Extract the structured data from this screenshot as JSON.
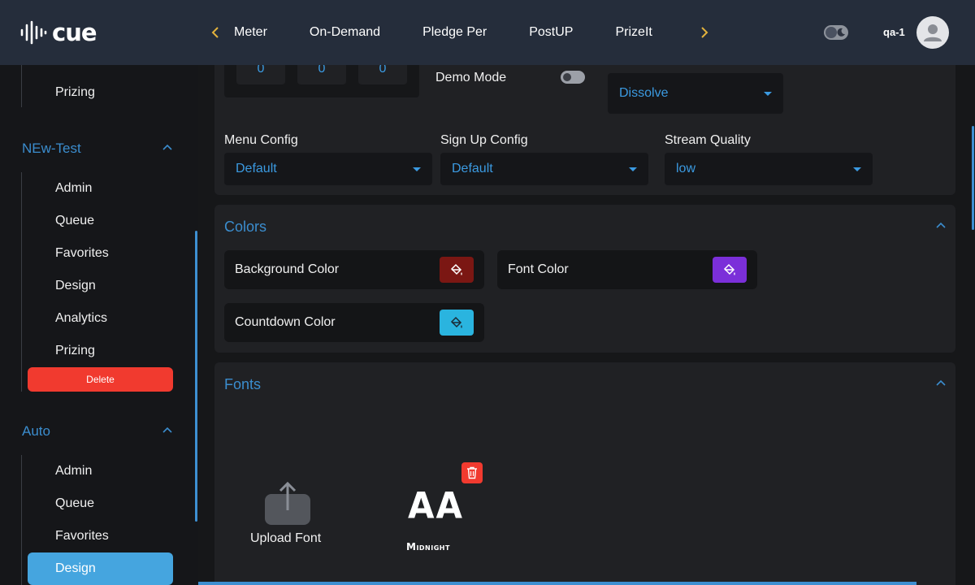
{
  "header": {
    "logo_text": "cue",
    "nav_tabs": [
      "Meter",
      "On-Demand",
      "Pledge Per",
      "PostUP",
      "PrizeIt"
    ],
    "username": "qa-1",
    "prev_icon": "chevron-left-icon",
    "next_icon": "chevron-right-icon",
    "theme_icon": "moon-icon",
    "accent_color": "#e3b23c"
  },
  "sidebar": {
    "top_item": "Prizing",
    "sections": [
      {
        "title": "NEw-Test",
        "items": [
          "Admin",
          "Queue",
          "Favorites",
          "Design",
          "Analytics",
          "Prizing"
        ],
        "delete_label": "Delete"
      },
      {
        "title": "Auto",
        "items": [
          "Admin",
          "Queue",
          "Favorites",
          "Design"
        ],
        "active_item": "Design"
      }
    ]
  },
  "settings": {
    "numbers": [
      "0",
      "0",
      "0"
    ],
    "demo_mode_label": "Demo Mode",
    "demo_mode_on": false,
    "transition_value": "Dissolve",
    "menu_config_label": "Menu Config",
    "menu_config_value": "Default",
    "signup_config_label": "Sign Up Config",
    "signup_config_value": "Default",
    "stream_quality_label": "Stream Quality",
    "stream_quality_value": "low"
  },
  "colors": {
    "title": "Colors",
    "items": [
      {
        "label": "Background Color",
        "color": "#7b1713"
      },
      {
        "label": "Font Color",
        "color": "#7b2fd9"
      },
      {
        "label": "Countdown Color",
        "color": "#2ab4df"
      }
    ]
  },
  "fonts": {
    "title": "Fonts",
    "upload_label": "Upload Font",
    "font_preview_text": "AA",
    "font_name": "Midnight"
  }
}
